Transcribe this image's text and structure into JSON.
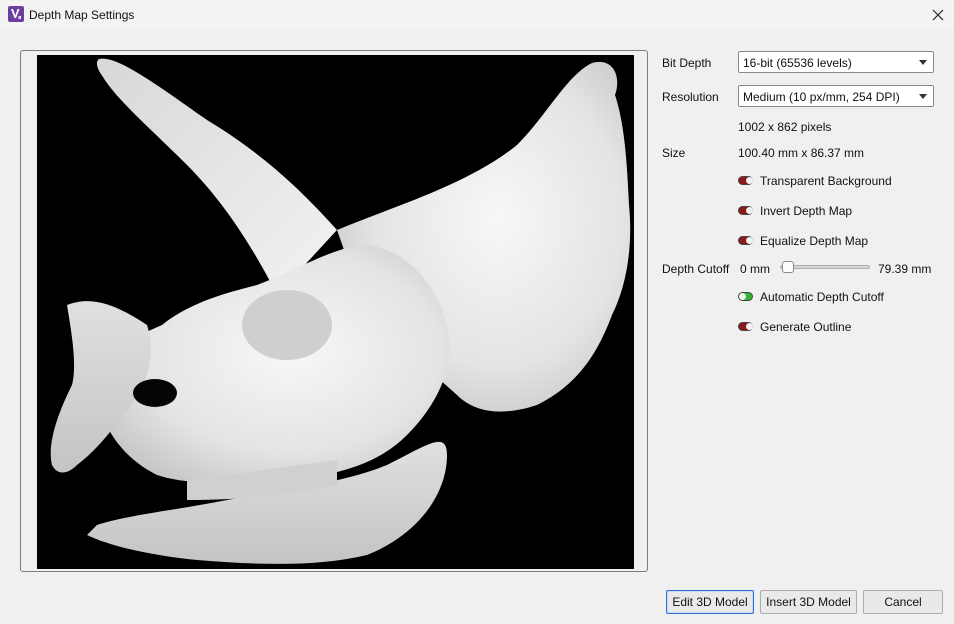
{
  "window": {
    "title": "Depth Map Settings",
    "icon": "app-logo-icon",
    "close_icon": "close-icon"
  },
  "preview": {
    "description_icon": "depth-map-image"
  },
  "settings": {
    "bit_depth_label": "Bit Depth",
    "bit_depth_value": "16-bit (65536 levels)",
    "resolution_label": "Resolution",
    "resolution_value": "Medium (10 px/mm, 254 DPI)",
    "pixels_text": "1002 x 862 pixels",
    "size_label": "Size",
    "size_value": "100.40 mm x 86.37 mm",
    "transparent_background": {
      "label": "Transparent Background",
      "on": false
    },
    "invert_depth_map": {
      "label": "Invert Depth Map",
      "on": false
    },
    "equalize_depth_map": {
      "label": "Equalize Depth Map",
      "on": false
    },
    "depth_cutoff_label": "Depth Cutoff",
    "depth_cutoff_min": "0 mm",
    "depth_cutoff_max": "79.39 mm",
    "depth_cutoff_level": 0.0,
    "automatic_depth_cutoff": {
      "label": "Automatic Depth Cutoff",
      "on": true
    },
    "generate_outline": {
      "label": "Generate Outline",
      "on": false
    }
  },
  "buttons": {
    "edit_3d_model": "Edit 3D Model",
    "insert_3d_model": "Insert 3D Model",
    "cancel": "Cancel"
  },
  "colors": {
    "toggle_off": "#8b1a1a",
    "toggle_on": "#2fb52f",
    "accent_border": "#2f6fd0"
  }
}
